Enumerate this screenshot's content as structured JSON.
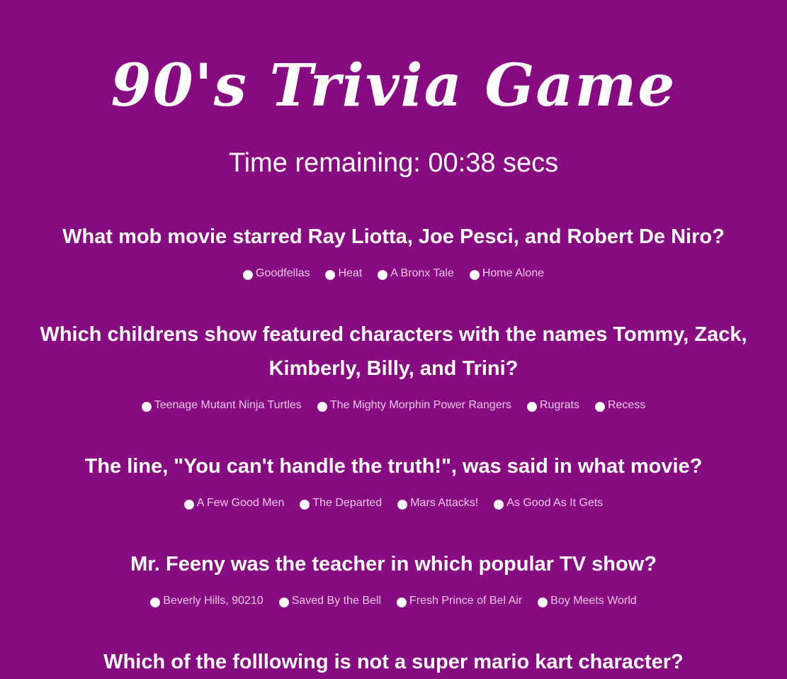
{
  "title": "90's Trivia Game",
  "timer": {
    "text": "Time remaining: 00:38 secs"
  },
  "questions": [
    {
      "text": "What mob movie starred Ray Liotta, Joe Pesci, and Robert De Niro?",
      "options": [
        "Goodfellas",
        "Heat",
        "A Bronx Tale",
        "Home Alone"
      ]
    },
    {
      "text": "Which childrens show featured characters with the names Tommy, Zack, Kimberly, Billy, and Trini?",
      "options": [
        "Teenage Mutant Ninja Turtles",
        "The Mighty Morphin Power Rangers",
        "Rugrats",
        "Recess"
      ]
    },
    {
      "text": "The line, \"You can't handle the truth!\", was said in what movie?",
      "options": [
        "A Few Good Men",
        "The Departed",
        "Mars Attacks!",
        "As Good As It Gets"
      ]
    },
    {
      "text": "Mr. Feeny was the teacher in which popular TV show?",
      "options": [
        "Beverly Hills, 90210",
        "Saved By the Bell",
        "Fresh Prince of Bel Air",
        "Boy Meets World"
      ]
    },
    {
      "text": "Which of the folllowing is not a super mario kart character?"
    }
  ]
}
